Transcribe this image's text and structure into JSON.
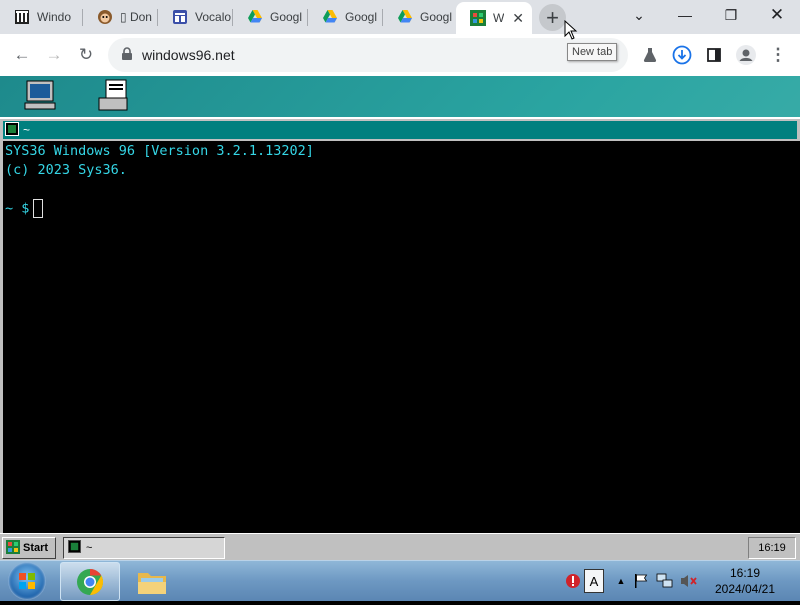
{
  "browser": {
    "tabs": [
      {
        "title": "Windo",
        "icon": "museum-icon"
      },
      {
        "title": "▯ Don",
        "icon": "monkey-icon"
      },
      {
        "title": "Vocalo",
        "icon": "table-icon"
      },
      {
        "title": "Googl",
        "icon": "google-drive-icon"
      },
      {
        "title": "Googl",
        "icon": "google-drive-icon"
      },
      {
        "title": "Googl",
        "icon": "google-drive-icon"
      },
      {
        "title": "W",
        "icon": "windows96-icon",
        "active": true
      }
    ],
    "new_tab_symbol": "+",
    "tooltip": "New tab",
    "url": "windows96.net"
  },
  "w96": {
    "terminal_title": "~",
    "terminal_lines": [
      "SYS36 Windows 96 [Version 3.2.1.13202]",
      "(c) 2023 Sys36."
    ],
    "prompt": "~ $",
    "start_label": "Start",
    "task_label": "~",
    "clock": "16:19"
  },
  "win7": {
    "time": "16:19",
    "date": "2024/04/21",
    "ime_label": "A"
  },
  "colors": {
    "terminal_text": "#35d6e6",
    "title_bar": "#00807f",
    "desktop": "#2aa4a1"
  }
}
